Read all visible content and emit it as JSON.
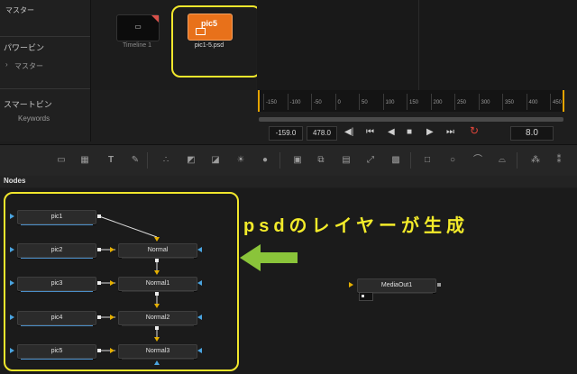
{
  "media_pool": {
    "master_label": "マスター",
    "power_bins_label": "パワービン",
    "power_bins_master": "マスター",
    "smart_bins_label": "スマートビン",
    "keywords_label": "Keywords"
  },
  "clips": [
    {
      "name": "Timeline 1",
      "thumb_text": "▭",
      "selected": false
    },
    {
      "name": "pic1-5.psd",
      "thumb_text": "pic5",
      "selected": true
    }
  ],
  "timeline_ruler": {
    "ticks": [
      "-150",
      "-100",
      "-50",
      "0",
      "50",
      "100",
      "150",
      "200",
      "250",
      "300",
      "350",
      "400",
      "450"
    ]
  },
  "transport": {
    "in_value": "-159.0",
    "out_value": "478.0",
    "current_frame": "8.0"
  },
  "toolbar": {
    "icons": [
      "background-icon",
      "paint-icon",
      "text-icon",
      "brush-icon",
      "particles-icon",
      "brightness-contrast-icon",
      "color-curves-icon",
      "color-corrector-icon",
      "blur-icon",
      "merge-icon",
      "transform-icon",
      "viewer-icon",
      "resize-icon",
      "matte-icon",
      "rectangle-mask-icon",
      "ellipse-mask-icon",
      "polygon-mask-icon",
      "bspline-mask-icon",
      "particle-emitter-icon",
      "particle-render-icon"
    ]
  },
  "nodes_panel": {
    "title": "Nodes",
    "loaders": [
      "pic1",
      "pic2",
      "pic3",
      "pic4",
      "pic5"
    ],
    "merges": [
      "Normal",
      "Normal1",
      "Normal2",
      "Normal3"
    ],
    "media_out": "MediaOut1"
  },
  "annotation": {
    "text": "psdのレイヤーが生成",
    "color": "#f3eb2a"
  },
  "colors": {
    "highlight": "#f0e62c",
    "arrow_green": "#8ac43a",
    "accent_orange": "#e8711a",
    "loop_red": "#e0453a"
  }
}
